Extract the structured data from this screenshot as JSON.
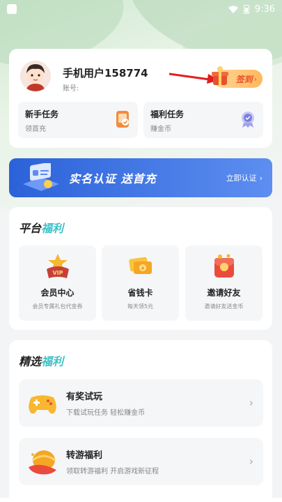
{
  "status": {
    "time": "9:36"
  },
  "profile": {
    "username": "手机用户158774",
    "account_label": "账号:",
    "signin_label": "签到",
    "signin_chevron": "›"
  },
  "tasks": [
    {
      "title": "新手任务",
      "subtitle": "领首充",
      "icon": "phone-gift-icon"
    },
    {
      "title": "福利任务",
      "subtitle": "赚金币",
      "icon": "medal-icon"
    }
  ],
  "banner": {
    "title": "实名认证 送首充",
    "action": "立即认证",
    "chevron": "›"
  },
  "platform": {
    "title_a": "平台",
    "title_b": "福利",
    "items": [
      {
        "title": "会员中心",
        "subtitle": "会员专属礼包代金券",
        "icon": "vip-crown-icon"
      },
      {
        "title": "省钱卡",
        "subtitle": "每天领5元",
        "icon": "ticket-card-icon"
      },
      {
        "title": "邀请好友",
        "subtitle": "邀请好友送金币",
        "icon": "red-envelope-icon"
      }
    ]
  },
  "featured": {
    "title_a": "精选",
    "title_b": "福利",
    "items": [
      {
        "title": "有奖试玩",
        "subtitle": "下载试玩任务 轻松赚金币",
        "icon": "gamepad-icon",
        "chevron": "›"
      },
      {
        "title": "转游福利",
        "subtitle": "领取转游福利 开启游戏新征程",
        "icon": "transfer-game-icon",
        "chevron": "›"
      }
    ]
  },
  "colors": {
    "accent_teal": "#3ec1c8",
    "banner_blue": "#2b62d9",
    "signin_orange": "#ffb85c",
    "signin_text": "#e8502c"
  }
}
